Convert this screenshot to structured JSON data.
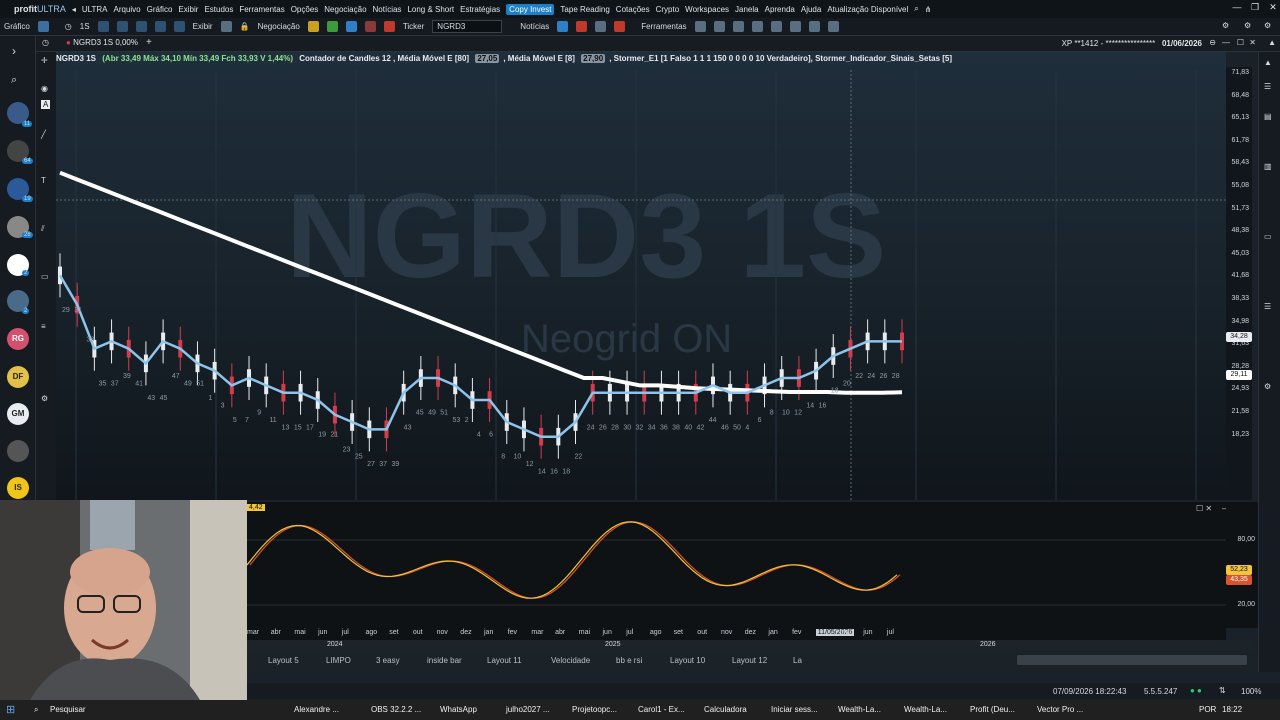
{
  "titlebar": {
    "brand": "profit",
    "brand_suffix": "ULTRA",
    "menu": [
      "ULTRA",
      "Arquivo",
      "Gráfico",
      "Exibir",
      "Estudos",
      "Ferramentas",
      "Opções",
      "Negociação",
      "Notícias",
      "Long & Short",
      "Estratégias"
    ],
    "copy_invest": "Copy Invest",
    "menu2": [
      "Tape Reading",
      "Cotações",
      "Crypto",
      "Workspaces",
      "Janela",
      "Aprenda",
      "Ajuda",
      "Atualização Disponível"
    ]
  },
  "toolbar": {
    "grafico": "Gráfico",
    "timeframe": "1S",
    "exibir": "Exibir",
    "negociacao": "Negociação",
    "ticker_label": "Ticker",
    "ticker_value": "NGRD3",
    "noticias": "Notícias",
    "ferramentas": "Ferramentas"
  },
  "tabbar": {
    "tab_label": "NGRD3 1S",
    "tab_change": "0,00%",
    "add": "+",
    "account": "XP **1412 - ****************",
    "date": "01/06/2026"
  },
  "infobar": {
    "symbol": "NGRD3 1S",
    "ohlc": "(Abr 33,49 Máx 34,10 Mín 33,49 Fch 33,93 V 1,44%)",
    "indicators_a": "Contador de Candles 12 , Média Móvel E [80]",
    "ma80_value": "27,05",
    "indicators_b": ", Média Móvel E [8]",
    "ma8_value": "27,90",
    "indicators_c": ", Stormer_E1 [1 Falso 1 1 1 150 0 0 0 0 10 Verdadeiro], Stormer_Indicador_Sinais_Setas [5]"
  },
  "watermark": {
    "ticker": "NGRD3 1S",
    "name": "Neogrid ON"
  },
  "sidebar_avatars": [
    "RG",
    "DF",
    "GM",
    "IS"
  ],
  "badges": [
    "11",
    "64",
    "19",
    "28",
    "2",
    "2"
  ],
  "chart_data": {
    "type": "candlestick",
    "y_ticks": [
      "71,83",
      "68,48",
      "65,13",
      "61,78",
      "58,43",
      "55,08",
      "51,73",
      "48,38",
      "45,03",
      "41,68",
      "38,33",
      "34,98",
      "31,63",
      "28,28",
      "24,93",
      "21,58",
      "18,23"
    ],
    "last_price": "34,28",
    "last_price_2": "33,93",
    "ma80_tag": "29,11",
    "counts": [
      "29",
      "31",
      "33",
      "35",
      "37",
      "39",
      "41",
      "43",
      "45",
      "47",
      "49",
      "51",
      "1",
      "3",
      "5",
      "7",
      "9",
      "11",
      "13",
      "15",
      "17",
      "19",
      "21",
      "23",
      "25",
      "27",
      "37",
      "39",
      "43",
      "45",
      "49",
      "51",
      "53",
      "2",
      "4",
      "6",
      "8",
      "10",
      "12",
      "14",
      "16",
      "18",
      "22",
      "24",
      "26",
      "28",
      "30",
      "32",
      "34",
      "36",
      "38",
      "40",
      "42",
      "44",
      "46",
      "50",
      "4",
      "6",
      "8",
      "10",
      "12",
      "14",
      "16",
      "18",
      "20",
      "22",
      "24",
      "26",
      "28"
    ],
    "ma8_series": [
      43,
      39,
      33,
      34,
      33,
      31,
      34,
      33,
      31,
      30,
      28,
      29,
      28,
      27,
      27,
      26,
      24,
      23,
      22,
      22,
      27,
      29,
      29,
      28,
      26,
      26,
      23,
      22,
      21,
      21,
      23,
      27,
      27,
      27,
      27,
      27,
      27,
      27,
      28,
      27,
      27,
      28,
      29,
      29,
      30,
      32,
      33,
      34,
      34,
      34
    ],
    "ma80_series": [
      57,
      56,
      55,
      54,
      53,
      52,
      51,
      50,
      49,
      48,
      47,
      46,
      45,
      44,
      43,
      42,
      41,
      40,
      39,
      38,
      37,
      36,
      35,
      34,
      33,
      32,
      31,
      30,
      29,
      29,
      28.5,
      28,
      28,
      27.8,
      27.6,
      27.5,
      27.4,
      27.3,
      27.2,
      27.1,
      27.1,
      27.1,
      27,
      27,
      27,
      27.05
    ],
    "osc_ticks": [
      "80,00",
      "20,00"
    ],
    "osc_tags": [
      "52,23",
      "43,35"
    ],
    "osc_top_tag": "4,42",
    "time_labels": [
      "mar",
      "abr",
      "mai",
      "jun",
      "jul",
      "ago",
      "set",
      "out",
      "nov",
      "dez",
      "jan",
      "fev",
      "mar",
      "abr",
      "mai",
      "jun",
      "jul",
      "ago",
      "set",
      "out",
      "nov",
      "dez",
      "jan",
      "fev",
      "11/05/2026",
      "mai",
      "jun",
      "jul"
    ],
    "years": [
      "2024",
      "2025",
      "2026"
    ]
  },
  "layouts": [
    "Layout 5",
    "LIMPO",
    "3 easy",
    "inside bar",
    "Layout 11",
    "Velocidade",
    "bb e rsi",
    "Layout 10",
    "Layout 12",
    "La"
  ],
  "status": {
    "datetime": "07/09/2026 18:22:43",
    "version": "5.5.5.247",
    "zoom": "100%"
  },
  "taskbar": {
    "search": "Pesquisar",
    "apps": [
      "Alexandre ...",
      "OBS 32.2.2 ...",
      "WhatsApp",
      "julho2027 ...",
      "Projetoopc...",
      "Carol1 - Ex...",
      "Calculadora",
      "Iniciar sess...",
      "Wealth-La...",
      "Wealth-La...",
      "Profit (Deu...",
      "Vector Pro ..."
    ],
    "lang": "POR",
    "time": "18:22"
  },
  "colors": {
    "ma80": "#ffffff",
    "ma8": "#8ec3ea",
    "bull": "#e8ecef",
    "bear": "#d23d4c",
    "osc_fast": "#f2c53d",
    "osc_slow": "#d9542c"
  }
}
